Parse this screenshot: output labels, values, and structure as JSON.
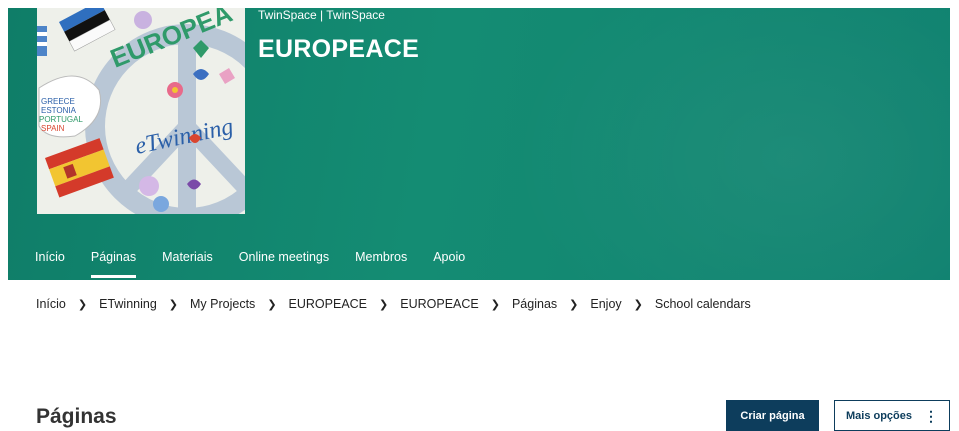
{
  "header": {
    "top_crumb": "TwinSpace | TwinSpace",
    "project_title": "EUROPEACE"
  },
  "logo_art": {
    "arc_text": "EUROPEA",
    "center_text": "eTwinning",
    "country_words": [
      "GREECE",
      "ESTONIA",
      "PORTUGAL",
      "SPAIN"
    ]
  },
  "tabs": [
    {
      "label": "Início",
      "active": false
    },
    {
      "label": "Páginas",
      "active": true
    },
    {
      "label": "Materiais",
      "active": false
    },
    {
      "label": "Online meetings",
      "active": false
    },
    {
      "label": "Membros",
      "active": false
    },
    {
      "label": "Apoio",
      "active": false
    }
  ],
  "breadcrumb": [
    "Início",
    "ETwinning",
    "My Projects",
    "EUROPEACE",
    "EUROPEACE",
    "Páginas",
    "Enjoy",
    "School calendars"
  ],
  "page": {
    "heading": "Páginas",
    "create_button": "Criar página",
    "more_options_button": "Mais opções"
  },
  "colors": {
    "banner": "#148c73",
    "primary_button": "#0d3d5c"
  }
}
